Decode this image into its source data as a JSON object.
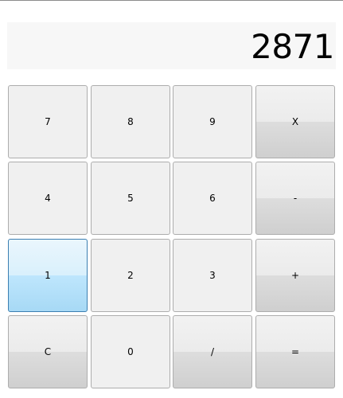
{
  "display": {
    "value": "2871"
  },
  "keys": [
    {
      "label": "7"
    },
    {
      "label": "8"
    },
    {
      "label": "9"
    },
    {
      "label": "X"
    },
    {
      "label": "4"
    },
    {
      "label": "5"
    },
    {
      "label": "6"
    },
    {
      "label": "-"
    },
    {
      "label": "1"
    },
    {
      "label": "2"
    },
    {
      "label": "3"
    },
    {
      "label": "+"
    },
    {
      "label": "C"
    },
    {
      "label": "0"
    },
    {
      "label": "/"
    },
    {
      "label": "="
    }
  ],
  "colors": {
    "accent_border": "#3c7fb1",
    "key_border": "#adadad",
    "display_bg": "#f7f7f7"
  }
}
